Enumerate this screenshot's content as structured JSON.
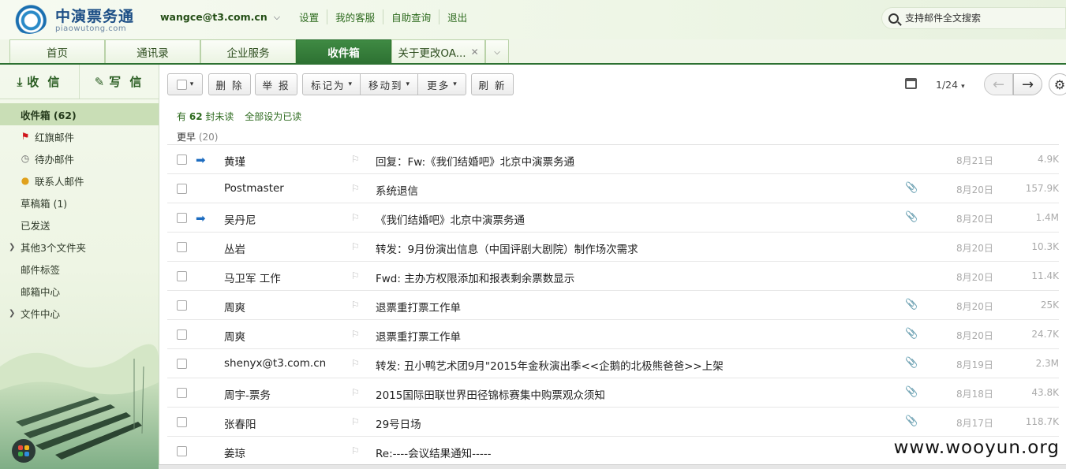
{
  "header": {
    "logo_cn": "中演票务通",
    "logo_en": "piaowutong.com",
    "user_email": "wangce@t3.com.cn",
    "links": [
      "设置",
      "我的客服",
      "自助查询",
      "退出"
    ],
    "search_placeholder": "支持邮件全文搜索"
  },
  "tabs": [
    {
      "label": "首页"
    },
    {
      "label": "通讯录"
    },
    {
      "label": "企业服务"
    },
    {
      "label": "收件箱",
      "active": true
    },
    {
      "label": "关于更改OA..."
    }
  ],
  "sidebar": {
    "receive_label": "收 信",
    "compose_label": "写 信",
    "folders": [
      {
        "label": "收件箱 (62)",
        "active": true
      },
      {
        "label": "红旗邮件",
        "icon": "red-flag-icon"
      },
      {
        "label": "待办邮件",
        "icon": "clock-icon"
      },
      {
        "label": "联系人邮件",
        "icon": "person-icon"
      },
      {
        "label": "草稿箱 (1)"
      },
      {
        "label": "已发送"
      },
      {
        "label": "其他3个文件夹",
        "expandable": true
      },
      {
        "label": "邮件标签"
      },
      {
        "label": "邮箱中心"
      },
      {
        "label": "文件中心",
        "expandable": true
      }
    ]
  },
  "toolbar": {
    "delete_label": "删 除",
    "report_label": "举 报",
    "mark_label": "标记为",
    "move_label": "移动到",
    "more_label": "更多",
    "refresh_label": "刷 新",
    "pager": "1/24"
  },
  "summary": {
    "unread_prefix": "有",
    "unread_count": "62",
    "unread_suffix": "封未读",
    "mark_all": "全部设为已读"
  },
  "group": {
    "label": "更早",
    "count": "(20)"
  },
  "emails": [
    {
      "sender": "黄瑾",
      "subject": "回复：Fw:《我们结婚吧》北京中演票务通",
      "attachment": false,
      "replied": true,
      "date": "8月21日",
      "size": "4.9K"
    },
    {
      "sender": "Postmaster",
      "subject": "系统退信",
      "attachment": true,
      "replied": false,
      "date": "8月20日",
      "size": "157.9K"
    },
    {
      "sender": "吴丹尼",
      "subject": "《我们结婚吧》北京中演票务通",
      "attachment": true,
      "replied": true,
      "date": "8月20日",
      "size": "1.4M"
    },
    {
      "sender": "丛岩",
      "subject": "转发：9月份演出信息（中国评剧大剧院）制作场次需求",
      "attachment": false,
      "replied": false,
      "date": "8月20日",
      "size": "10.3K"
    },
    {
      "sender": "马卫军 工作",
      "subject": "Fwd: 主办方权限添加和报表剩余票数显示",
      "attachment": false,
      "replied": false,
      "date": "8月20日",
      "size": "11.4K"
    },
    {
      "sender": "周爽",
      "subject": "退票重打票工作单",
      "attachment": true,
      "replied": false,
      "date": "8月20日",
      "size": "25K"
    },
    {
      "sender": "周爽",
      "subject": "退票重打票工作单",
      "attachment": true,
      "replied": false,
      "date": "8月20日",
      "size": "24.7K"
    },
    {
      "sender": "shenyx@t3.com.cn",
      "subject": "转发: 丑小鸭艺术团9月\"2015年金秋演出季<<企鹅的北极熊爸爸>>上架",
      "attachment": true,
      "replied": false,
      "date": "8月19日",
      "size": "2.3M"
    },
    {
      "sender": "周宇-票务",
      "subject": "2015国际田联世界田径锦标赛集中购票观众须知",
      "attachment": true,
      "replied": false,
      "date": "8月18日",
      "size": "43.8K"
    },
    {
      "sender": "张春阳",
      "subject": "29号日场",
      "attachment": true,
      "replied": false,
      "date": "8月17日",
      "size": "118.7K"
    },
    {
      "sender": "姜琼",
      "subject": "Re:----会议结果通知-----",
      "attachment": false,
      "replied": false,
      "date": "",
      "size": ""
    }
  ],
  "watermark": "www.wooyun.org"
}
